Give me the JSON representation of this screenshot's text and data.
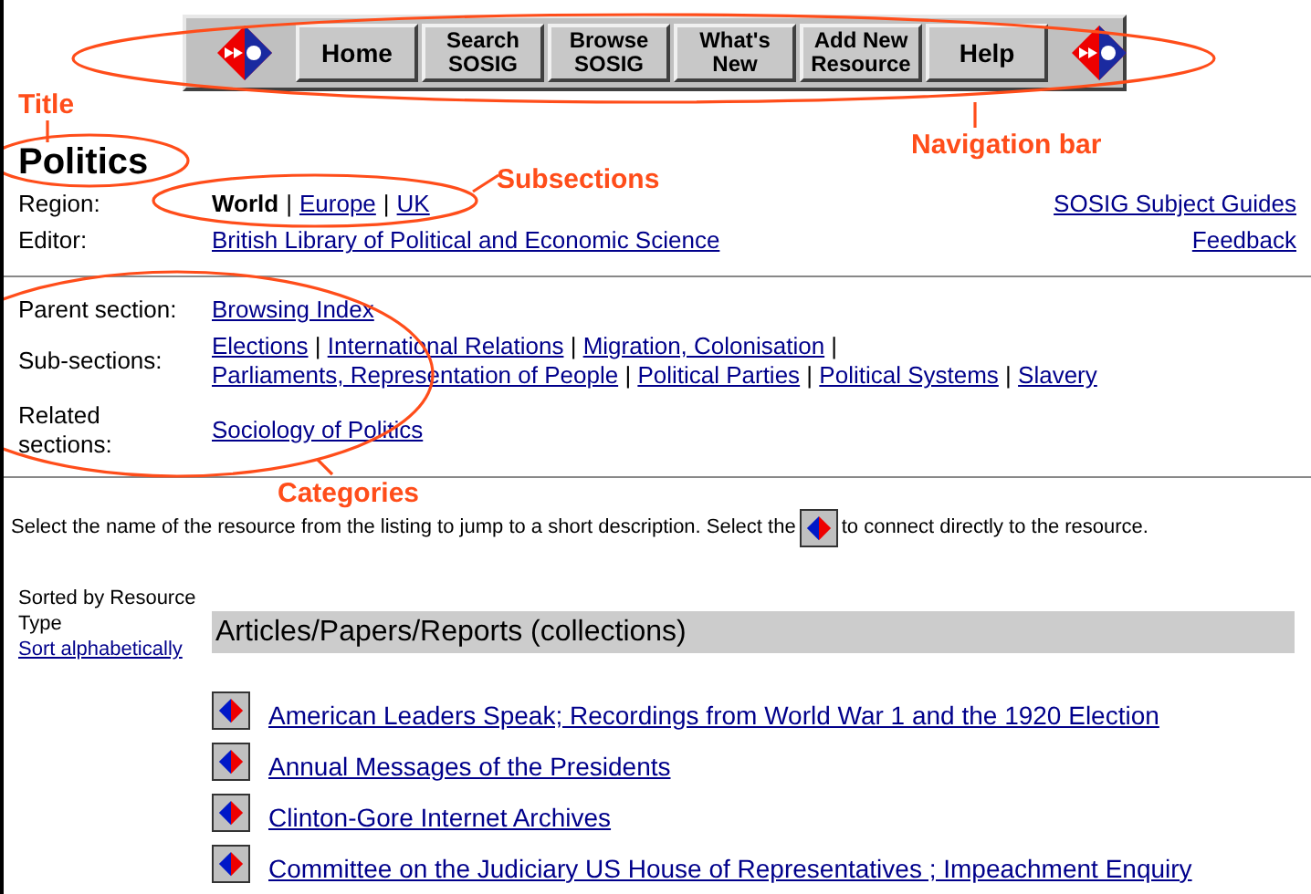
{
  "nav": {
    "buttons": [
      {
        "lines": [
          "Home"
        ]
      },
      {
        "lines": [
          "Search",
          "SOSIG"
        ]
      },
      {
        "lines": [
          "Browse",
          "SOSIG"
        ]
      },
      {
        "lines": [
          "What's",
          "New"
        ]
      },
      {
        "lines": [
          "Add New",
          "Resource"
        ]
      },
      {
        "lines": [
          "Help"
        ]
      }
    ]
  },
  "title": "Politics",
  "separator": "|",
  "region": {
    "label": "Region:",
    "items": [
      {
        "text": "World",
        "selected": true
      },
      {
        "text": "Europe",
        "selected": false
      },
      {
        "text": "UK",
        "selected": false
      }
    ]
  },
  "editor": {
    "label": "Editor:",
    "value": "British Library of Political and Economic Science"
  },
  "side_links": [
    "SOSIG Subject Guides",
    "Feedback"
  ],
  "categories": [
    {
      "label": "Parent section:",
      "links": [
        "Browsing Index"
      ]
    },
    {
      "label": "Sub-sections:",
      "links": [
        "Elections",
        "International Relations",
        "Migration, Colonisation",
        "Parliaments, Representation of People",
        "Political Parties",
        "Political Systems",
        "Slavery"
      ]
    },
    {
      "label": "Related sections:",
      "links": [
        "Sociology of Politics"
      ]
    }
  ],
  "instruction": {
    "before": "Select the name of the resource from the listing to jump to a short description. Select the",
    "after": "to connect directly to the resource."
  },
  "sort": {
    "label": "Sorted by Resource Type",
    "link": "Sort alphabetically"
  },
  "section_heading": "Articles/Papers/Reports (collections)",
  "resources": [
    "American Leaders Speak; Recordings from World War 1 and the 1920 Election",
    "Annual Messages of the Presidents",
    "Clinton-Gore Internet Archives",
    "Committee on the Judiciary US House of Representatives ; Impeachment Enquiry"
  ],
  "annotations": [
    "Title",
    "Navigation bar",
    "Subsections",
    "Categories"
  ]
}
